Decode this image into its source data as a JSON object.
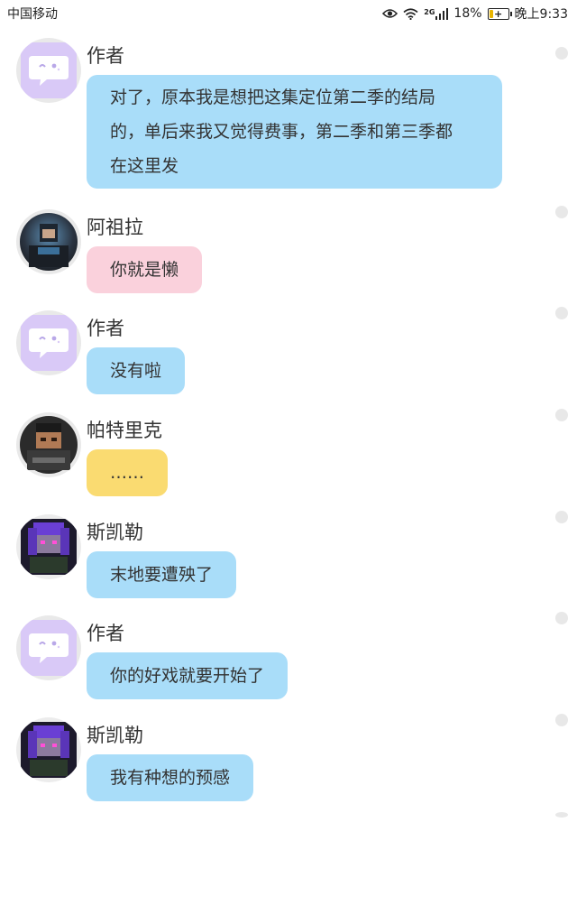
{
  "status_bar": {
    "carrier": "中国移动",
    "network": "2G",
    "battery": "18%",
    "time": "晚上9:33",
    "icons": [
      "eye-icon",
      "wifi-icon",
      "signal-icon",
      "battery-icon"
    ]
  },
  "colors": {
    "bubble_blue": "#a9ddf9",
    "bubble_pink": "#fad1dc",
    "bubble_yellow": "#fadb71",
    "author_avatar": "#d9c9f7"
  },
  "messages": [
    {
      "sender": "作者",
      "text": "对了，原本我是想把这集定位第二季的结局",
      "text2": "的，单后来我又觉得费事，第二季和第三季都",
      "text3": "在这里发"
    },
    {
      "sender": "阿祖拉",
      "text": "你就是懒"
    },
    {
      "sender": "作者",
      "text": "没有啦"
    },
    {
      "sender": "帕特里克",
      "text": "……"
    },
    {
      "sender": "斯凯勒",
      "text": "末地要遭殃了"
    },
    {
      "sender": "作者",
      "text": "你的好戏就要开始了"
    },
    {
      "sender": "斯凯勒",
      "text": "我有种想的预感"
    }
  ]
}
